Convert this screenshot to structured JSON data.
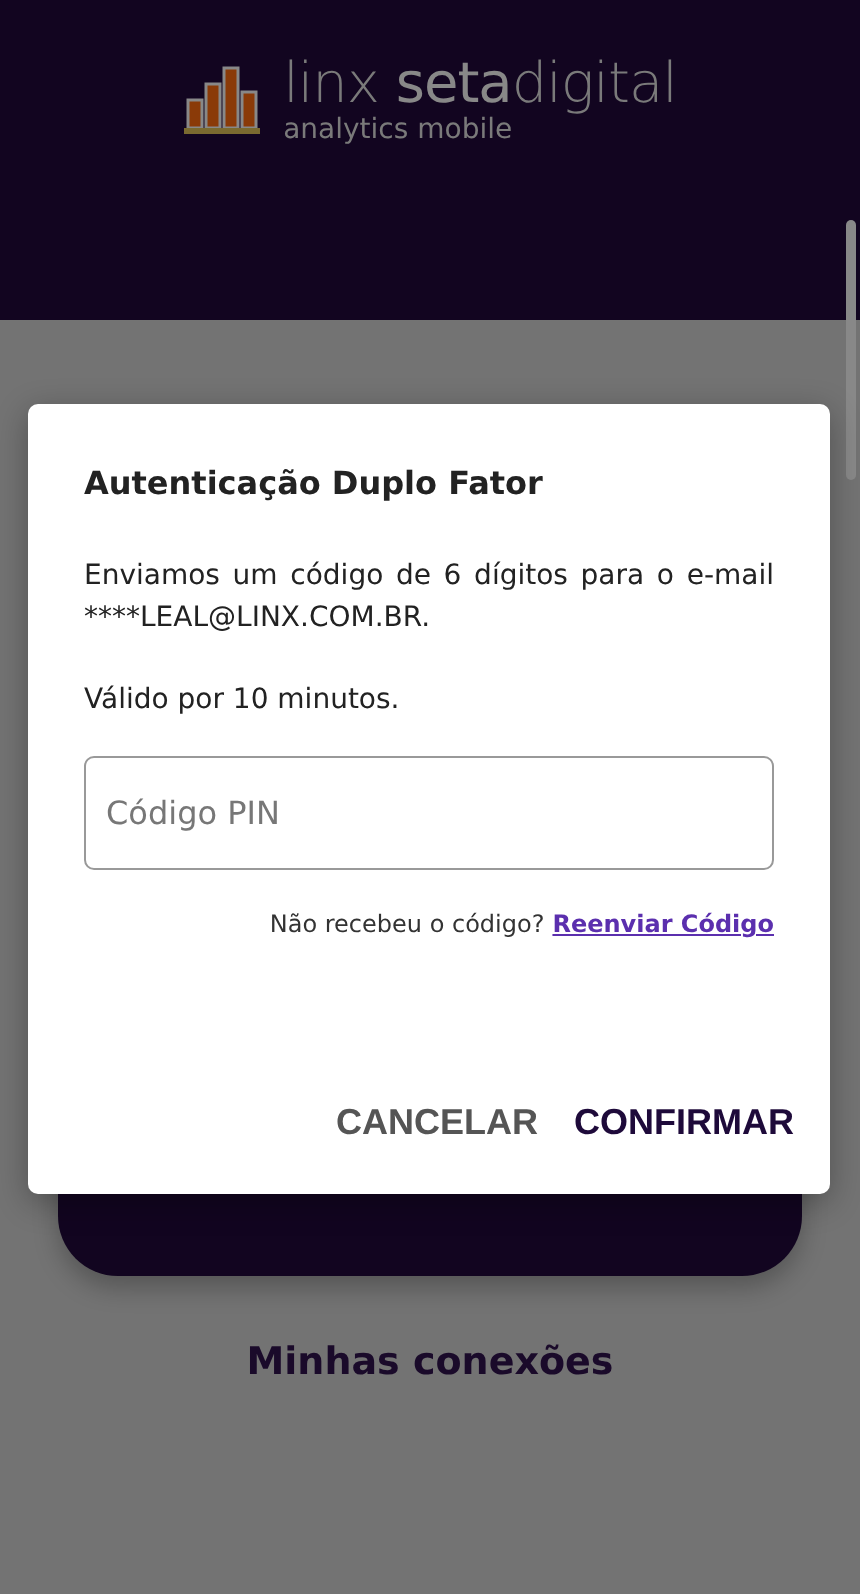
{
  "logo": {
    "name": "linx **seta**digital",
    "tagline": "analytics mobile"
  },
  "page": {
    "section_title": "Minhas conexões"
  },
  "dialog": {
    "title": "Autenticação Duplo Fator",
    "message": "Enviamos um código de 6 dígitos para o e-mail ****LEAL@LINX.COM.BR.",
    "validity": "Válido por 10 minutos.",
    "pin_field": {
      "placeholder": "Código PIN"
    },
    "resend_prompt": "Não recebeu o código?",
    "resend_link": "Reenviar Código",
    "buttons": [
      {
        "label": "CANCELAR",
        "kind": "secondary"
      },
      {
        "label": "CONFIRMAR",
        "kind": "primary"
      }
    ]
  }
}
